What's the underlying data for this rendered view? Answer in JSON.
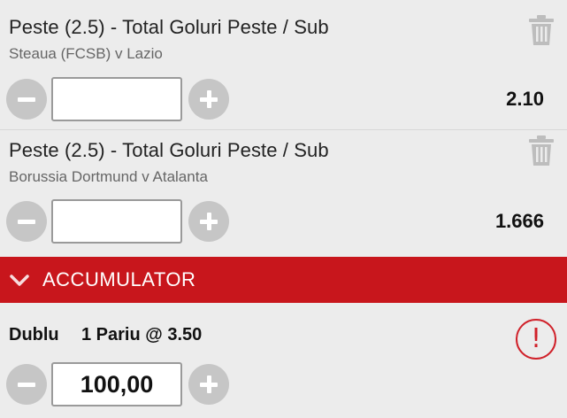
{
  "bets": [
    {
      "market": "Peste (2.5) - Total Goluri Peste / Sub",
      "event": "Steaua (FCSB) v Lazio",
      "odds": "2.10",
      "stake_value": ""
    },
    {
      "market": "Peste (2.5) - Total Goluri Peste / Sub",
      "event": "Borussia Dortmund v Atalanta",
      "odds": "1.666",
      "stake_value": ""
    }
  ],
  "accumulator": {
    "header_label": "ACCUMULATOR",
    "type": "Dublu",
    "summary": "1 Pariu @ 3.50",
    "stake_value": "100,00",
    "alert_glyph": "!"
  },
  "icons": {
    "trash": "trash-icon",
    "minus": "minus-icon",
    "plus": "plus-icon",
    "chevron": "chevron-down-icon",
    "alert": "alert-icon"
  },
  "colors": {
    "accent": "#c8161c",
    "background": "#ececec",
    "button_gray": "#c6c6c6",
    "alert": "#d0212a"
  }
}
